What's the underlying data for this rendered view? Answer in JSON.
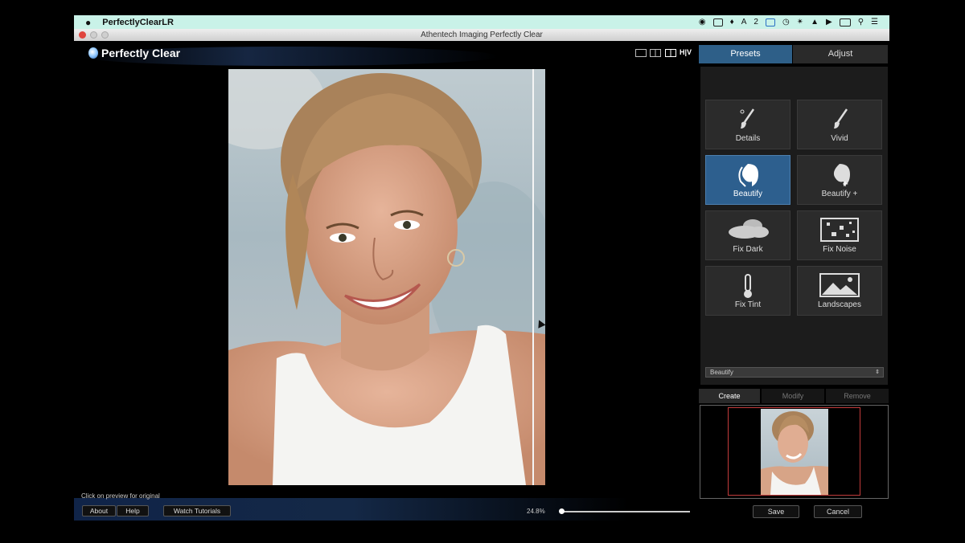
{
  "menubar": {
    "app_name": "PerfectlyClearLR",
    "status_text": "2"
  },
  "window": {
    "title": "Athentech Imaging Perfectly Clear"
  },
  "logo": {
    "text": "Perfectly Clear"
  },
  "view_modes": {
    "hv_label": "H|V"
  },
  "tabs": {
    "presets": "Presets",
    "adjust": "Adjust"
  },
  "presets": [
    {
      "label": "Details",
      "icon": "brush-icon"
    },
    {
      "label": "Vivid",
      "icon": "brush-icon"
    },
    {
      "label": "Beautify",
      "icon": "face-icon",
      "active": true
    },
    {
      "label": "Beautify +",
      "icon": "face-plus-icon"
    },
    {
      "label": "Fix Dark",
      "icon": "cloud-icon"
    },
    {
      "label": "Fix Noise",
      "icon": "noise-icon"
    },
    {
      "label": "Fix Tint",
      "icon": "thermometer-icon"
    },
    {
      "label": "Landscapes",
      "icon": "landscape-icon"
    }
  ],
  "preset_select": {
    "value": "Beautify"
  },
  "preset_actions": {
    "create": "Create",
    "modify": "Modify",
    "remove": "Remove"
  },
  "footer": {
    "hint": "Click on preview for original",
    "about": "About",
    "help": "Help",
    "tutorials": "Watch Tutorials",
    "zoom": "24.8%",
    "save": "Save",
    "cancel": "Cancel"
  },
  "colors": {
    "accent": "#2d5f8e",
    "menubar": "#c9f2e8",
    "preview_frame": "#c23b3b"
  }
}
